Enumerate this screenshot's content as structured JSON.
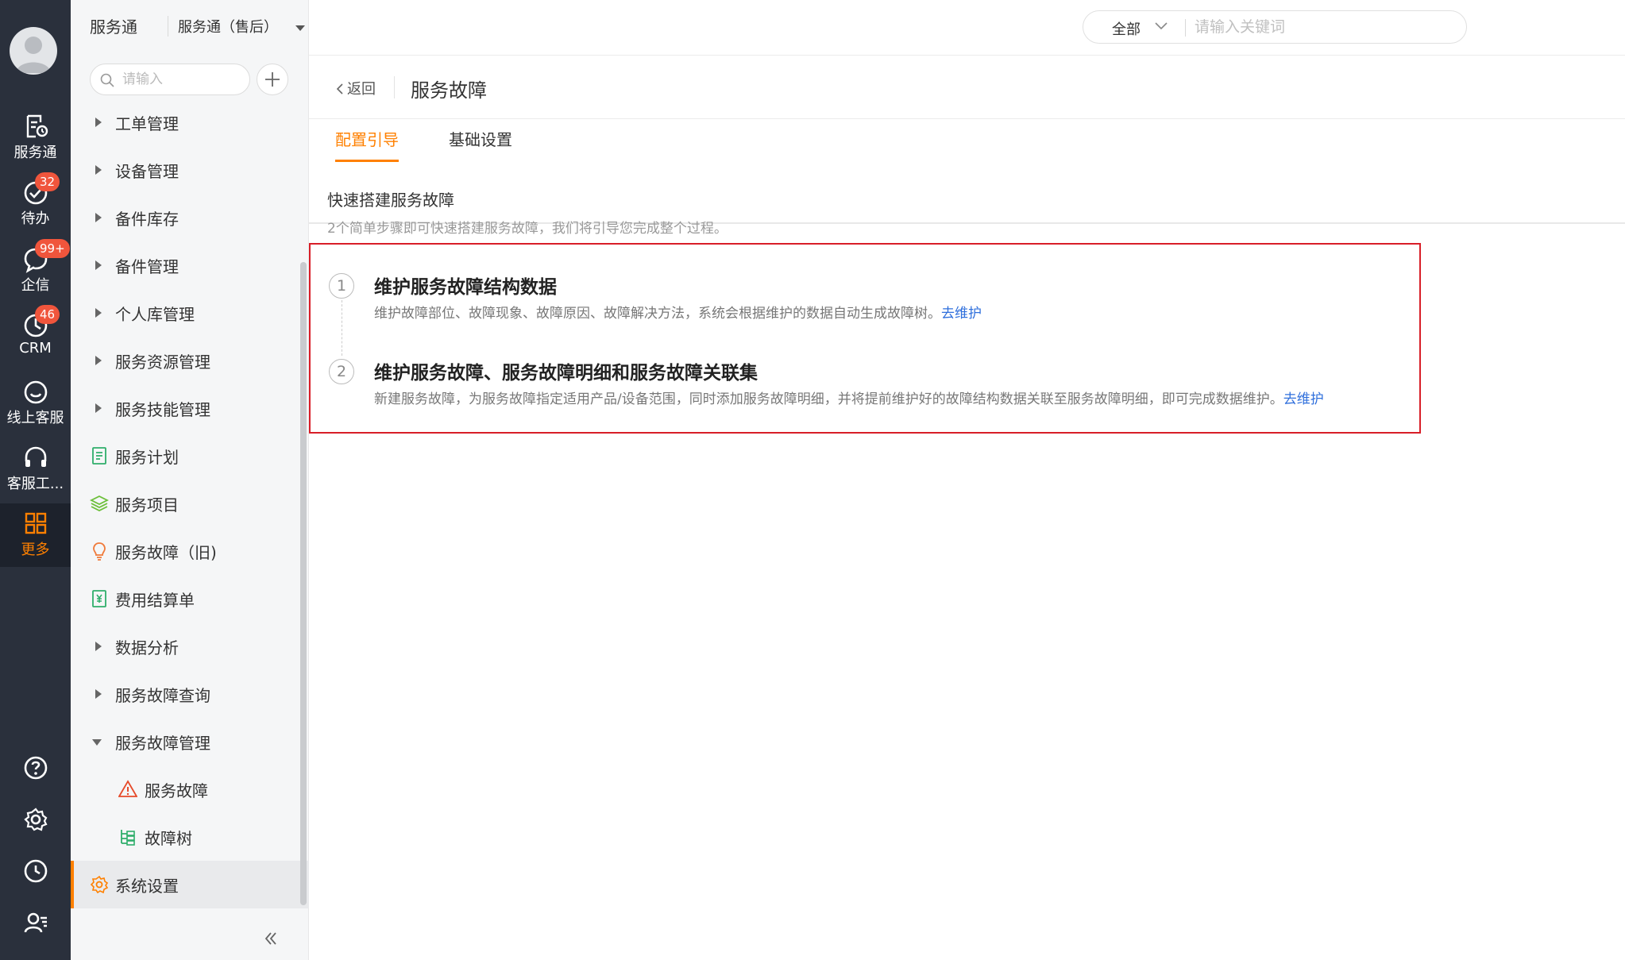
{
  "rail": {
    "items": [
      {
        "label": "服务通",
        "icon": "service-icon",
        "badge": ""
      },
      {
        "label": "待办",
        "icon": "todo-check-icon",
        "badge": "32"
      },
      {
        "label": "企信",
        "icon": "chat-icon",
        "badge": "99+"
      },
      {
        "label": "CRM",
        "icon": "crm-clock-icon",
        "badge": "46"
      },
      {
        "label": "线上客服",
        "icon": "online-service-icon",
        "badge": ""
      },
      {
        "label": "客服工...",
        "icon": "headset-icon",
        "badge": ""
      },
      {
        "label": "更多",
        "icon": "grid-more-icon",
        "badge": ""
      }
    ],
    "active_color": "#ff8000"
  },
  "sidebar": {
    "title": "服务通",
    "app_select": "服务通（售后）",
    "search_placeholder": "请输入",
    "items": [
      {
        "label": "工单管理"
      },
      {
        "label": "设备管理"
      },
      {
        "label": "备件库存"
      },
      {
        "label": "备件管理"
      },
      {
        "label": "个人库管理"
      },
      {
        "label": "服务资源管理"
      },
      {
        "label": "服务技能管理"
      },
      {
        "label": "服务计划"
      },
      {
        "label": "服务项目"
      },
      {
        "label": "服务故障（旧)"
      },
      {
        "label": "费用结算单"
      },
      {
        "label": "数据分析"
      },
      {
        "label": "服务故障查询"
      },
      {
        "label": "服务故障管理"
      },
      {
        "label": "服务故障"
      },
      {
        "label": "故障树"
      },
      {
        "label": "系统设置"
      }
    ]
  },
  "topbar": {
    "scope": "全部",
    "search_placeholder": "请输入关键词"
  },
  "page": {
    "back_label": "返回",
    "title": "服务故障",
    "tabs": [
      {
        "label": "配置引导"
      },
      {
        "label": "基础设置"
      }
    ],
    "guide_title": "快速搭建服务故障",
    "guide_subtitle": "2个简单步骤即可快速搭建服务故障，我们将引导您完成整个过程。",
    "steps": [
      {
        "num": "1",
        "title": "维护服务故障结构数据",
        "desc": "维护故障部位、故障现象、故障原因、故障解决方法，系统会根据维护的数据自动生成故障树。",
        "link": "去维护"
      },
      {
        "num": "2",
        "title": "维护服务故障、服务故障明细和服务故障关联集",
        "desc": "新建服务故障，为服务故障指定适用产品/设备范围，同时添加服务故障明细，并将提前维护好的故障结构数据关联至服务故障明细，即可完成数据维护。",
        "link": "去维护"
      }
    ]
  }
}
